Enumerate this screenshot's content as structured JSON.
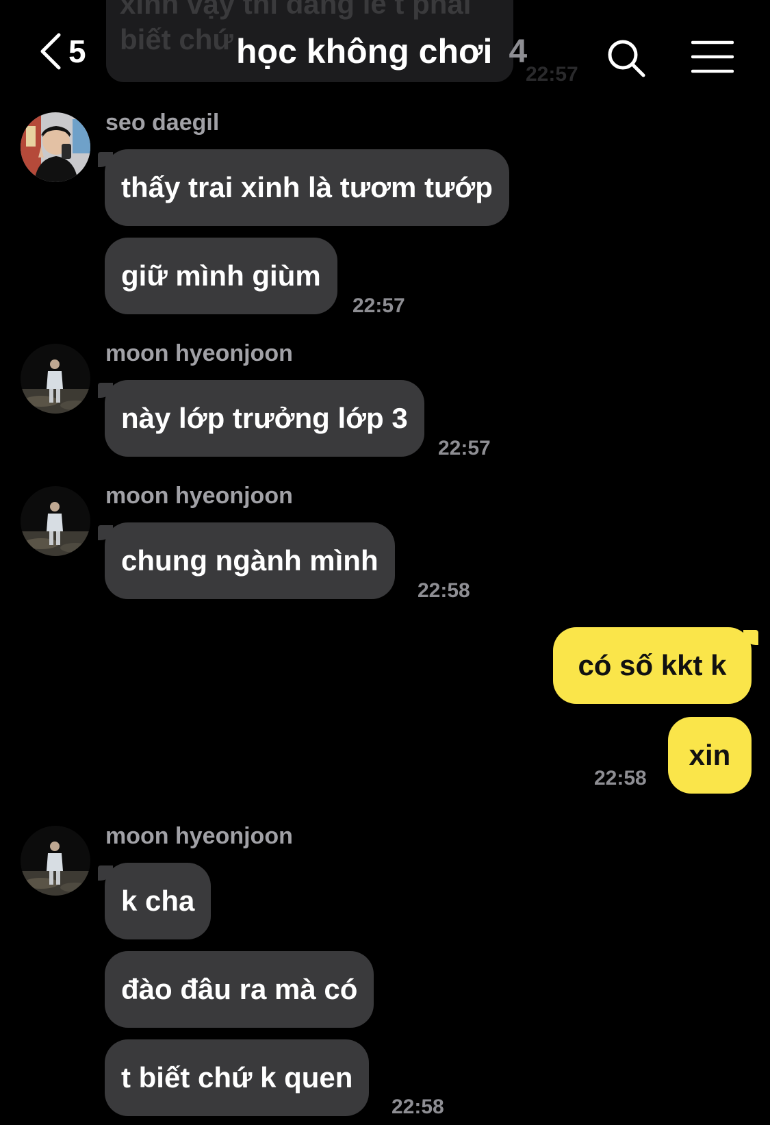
{
  "background_color": "#000000",
  "ghost": {
    "text_line1": "xinh vậy thì đáng lẽ t phải",
    "text_line2": "biết chứ",
    "time": "22:57"
  },
  "header": {
    "back_icon": "chevron-left-icon",
    "back_count": "5",
    "title": "học không chơi",
    "member_count": "4",
    "search_icon": "search-icon",
    "menu_icon": "menu-icon"
  },
  "colors": {
    "incoming_bubble": "#3a3a3c",
    "outgoing_bubble": "#fae54a",
    "sender_name": "#a1a1a6",
    "timestamp": "#8e8e93"
  },
  "messages": [
    {
      "sender": "seo daegil",
      "bubbles": [
        "thấy trai xinh là tươm tướp",
        "giữ mình giùm"
      ],
      "time": "22:57"
    },
    {
      "sender": "moon hyeonjoon",
      "bubbles": [
        "này lớp trưởng lớp 3"
      ],
      "time": "22:57"
    },
    {
      "sender": "moon hyeonjoon",
      "bubbles": [
        "chung ngành mình"
      ],
      "time": "22:58"
    },
    {
      "sender": "me",
      "bubbles": [
        "có số kkt k",
        "xin"
      ],
      "time": "22:58"
    },
    {
      "sender": "moon hyeonjoon",
      "bubbles": [
        "k cha",
        "đào đâu ra mà có",
        "t biết chứ k quen"
      ],
      "time": "22:58"
    }
  ]
}
